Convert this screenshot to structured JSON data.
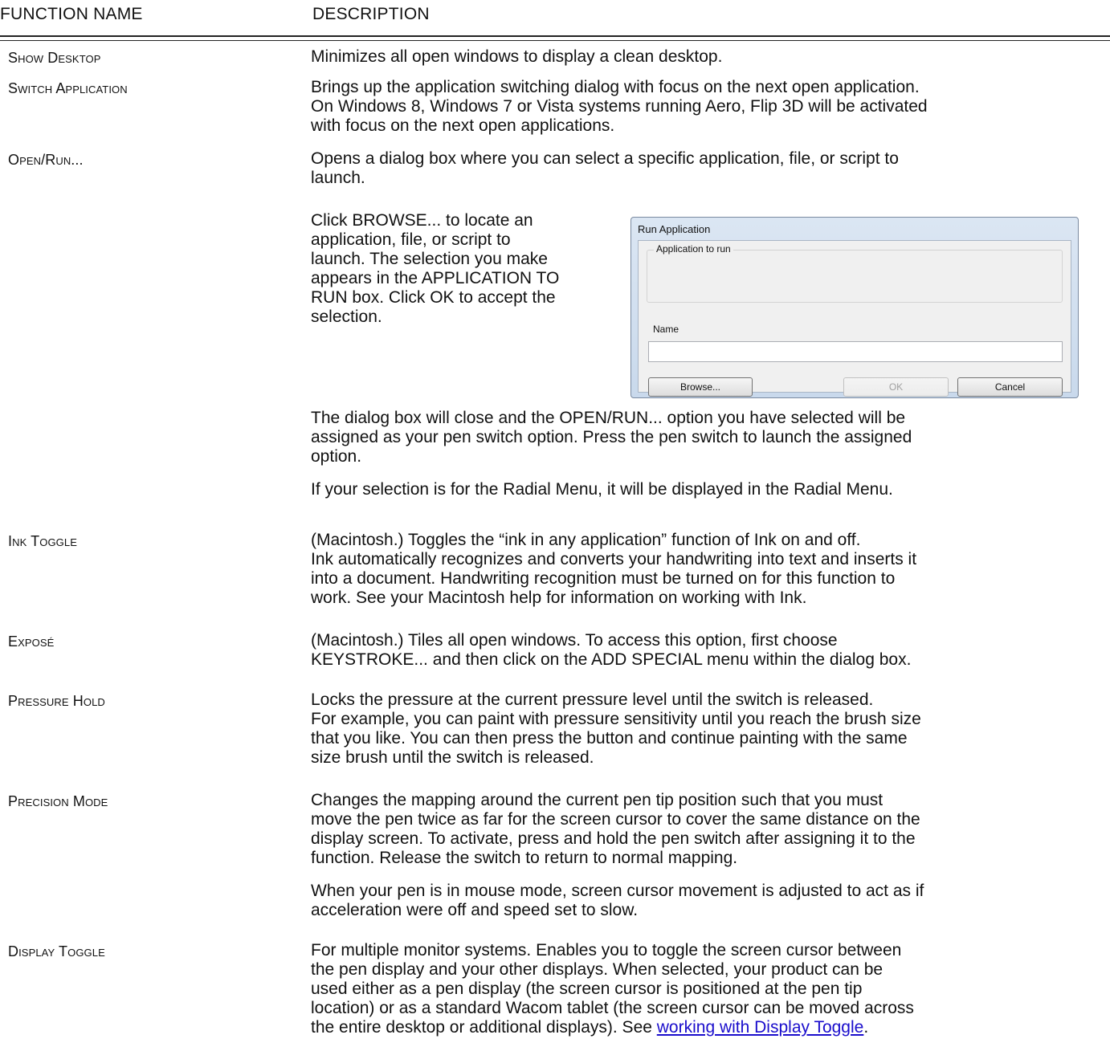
{
  "header": {
    "function_name": "FUNCTION NAME",
    "description": "DESCRIPTION"
  },
  "rows": [
    {
      "name": "Show Desktop",
      "desc": [
        "Minimizes all open windows to display a clean desktop."
      ]
    },
    {
      "name": "Switch Application",
      "desc": [
        "Brings up the application switching dialog with focus on the next open application.",
        "On Windows 8, Windows 7 or Vista systems running Aero, Flip 3D will be activated",
        "with focus on the next open applications."
      ]
    },
    {
      "name": "Open/Run...",
      "desc": [
        "Opens a dialog box where you can select a specific application, file, or script to",
        "launch."
      ]
    },
    {
      "name": "Ink Toggle",
      "desc": [
        "(Macintosh.) Toggles the “ink in any application” function of Ink on and off.",
        "Ink automatically recognizes and converts your handwriting into text and inserts it",
        "into a document. Handwriting recognition must be turned on for this function to",
        "work. See your Macintosh help for information on working with Ink."
      ]
    },
    {
      "name": "Exposé",
      "desc": [
        "(Macintosh.) Tiles all open windows. To access this option, first choose",
        "KEYSTROKE... and then click on the ADD SPECIAL menu within the dialog box."
      ]
    },
    {
      "name": "Pressure Hold",
      "desc": [
        "Locks the pressure at the current pressure level until the switch is released.",
        "For example, you can paint with pressure sensitivity until you reach the brush size",
        "that you like. You can then press the button and continue painting with the same",
        "size brush until the switch is released."
      ]
    },
    {
      "name": "Precision Mode",
      "desc": [
        "Changes the mapping around the current pen tip position such that you must",
        "move the pen twice as far for the screen cursor to cover the same distance on the",
        "display screen. To activate, press and hold the pen switch after assigning it to the",
        "function. Release the switch to return to normal mapping."
      ],
      "desc2": [
        "When your pen is in mouse mode, screen cursor movement is adjusted to act as if",
        "acceleration were off and speed set to slow."
      ]
    },
    {
      "name": "Display Toggle",
      "desc": [
        "For multiple monitor systems. Enables you to toggle the screen cursor between",
        "the pen display and your other displays. When selected, your product can be",
        "used either as a pen display (the screen cursor is positioned at the pen tip",
        "location) or as a standard Wacom tablet (the screen cursor can be moved across"
      ],
      "last_line_prefix": "the entire desktop or additional displays). See ",
      "link_text": "working with Display Toggle",
      "last_line_suffix": "."
    }
  ],
  "openrun_extra": {
    "browse_note": [
      "Click BROWSE... to locate an",
      "application, file, or script  to",
      "launch.  The selection you make",
      "appears in the APPLICATION TO",
      "RUN box.  Click OK to accept the",
      "selection."
    ],
    "after_dialog": [
      "The dialog box will close and the OPEN/RUN... option you have selected will be",
      "assigned as your pen switch option.  Press the pen switch to launch the assigned",
      "option."
    ],
    "radial_note": "If your selection is for the Radial Menu, it will be displayed in the Radial Menu."
  },
  "dialog": {
    "title": "Run Application",
    "group_label": "Application to run",
    "name_label": "Name",
    "name_value": "",
    "browse_label": "Browse...",
    "ok_label": "OK",
    "cancel_label": "Cancel"
  }
}
